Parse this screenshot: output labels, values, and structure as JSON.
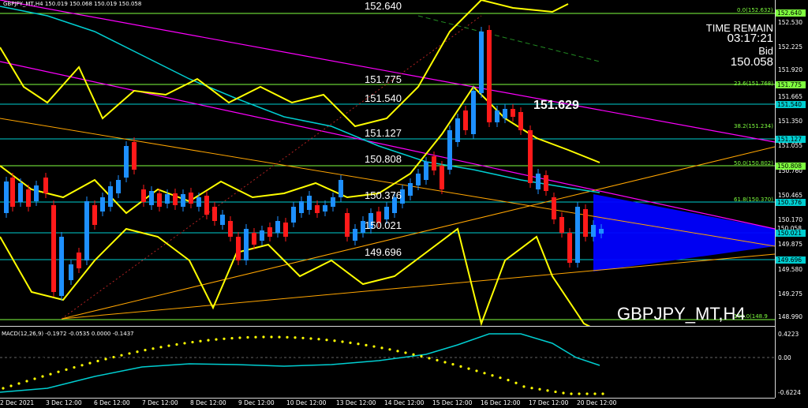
{
  "header": {
    "title": "GBPJPY_MT,H4  150.019 150.068 150.019 150.058"
  },
  "timer": {
    "label": "TIME REMAIN",
    "value": "03:17:21",
    "bid_label": "Bid",
    "bid_value": "150.058"
  },
  "symbol_label": "GBPJPY_MT,H4",
  "highlight_price": "151.629",
  "levels": [
    "152.640",
    "151.775",
    "151.540",
    "151.127",
    "150.808",
    "150.376",
    "150.021",
    "149.696"
  ],
  "fib_labels": [
    "0.0(152.632)",
    "23.6(151.768)",
    "38.2(151.234)",
    "50.0(150.802)",
    "61.8(150.370)",
    "100.0(148.9"
  ],
  "price_axis": [
    "152.530",
    "152.225",
    "151.920",
    "151.665",
    "151.350",
    "151.055",
    "150.760",
    "150.465",
    "150.170",
    "149.875",
    "149.580",
    "149.275",
    "148.990"
  ],
  "price_tags": [
    "152.640",
    "151.775",
    "151.540",
    "151.127",
    "150.808",
    "150.376",
    "150.058",
    "150.021",
    "149.696"
  ],
  "macd": {
    "label": "MACD(12,26,9) -0.1972 -0.0535 0.0000 -0.1437",
    "axis": [
      "0.4223",
      "0.00",
      "-0.6224"
    ]
  },
  "time_axis": [
    "2 Dec 2021",
    "3 Dec 12:00",
    "6 Dec 12:00",
    "7 Dec 12:00",
    "8 Dec 12:00",
    "9 Dec 12:00",
    "10 Dec 12:00",
    "13 Dec 12:00",
    "14 Dec 12:00",
    "15 Dec 12:00",
    "16 Dec 12:00",
    "17 Dec 12:00",
    "20 Dec 12:00"
  ],
  "colors": {
    "bull": "#1e90ff",
    "bear": "#ff1a1a",
    "band": "#ffff00",
    "fib": "#7fff3f",
    "ma": "#00ced1",
    "trend": "#ff00ff",
    "support": "#ffa500",
    "zone": "#0000ff"
  }
}
